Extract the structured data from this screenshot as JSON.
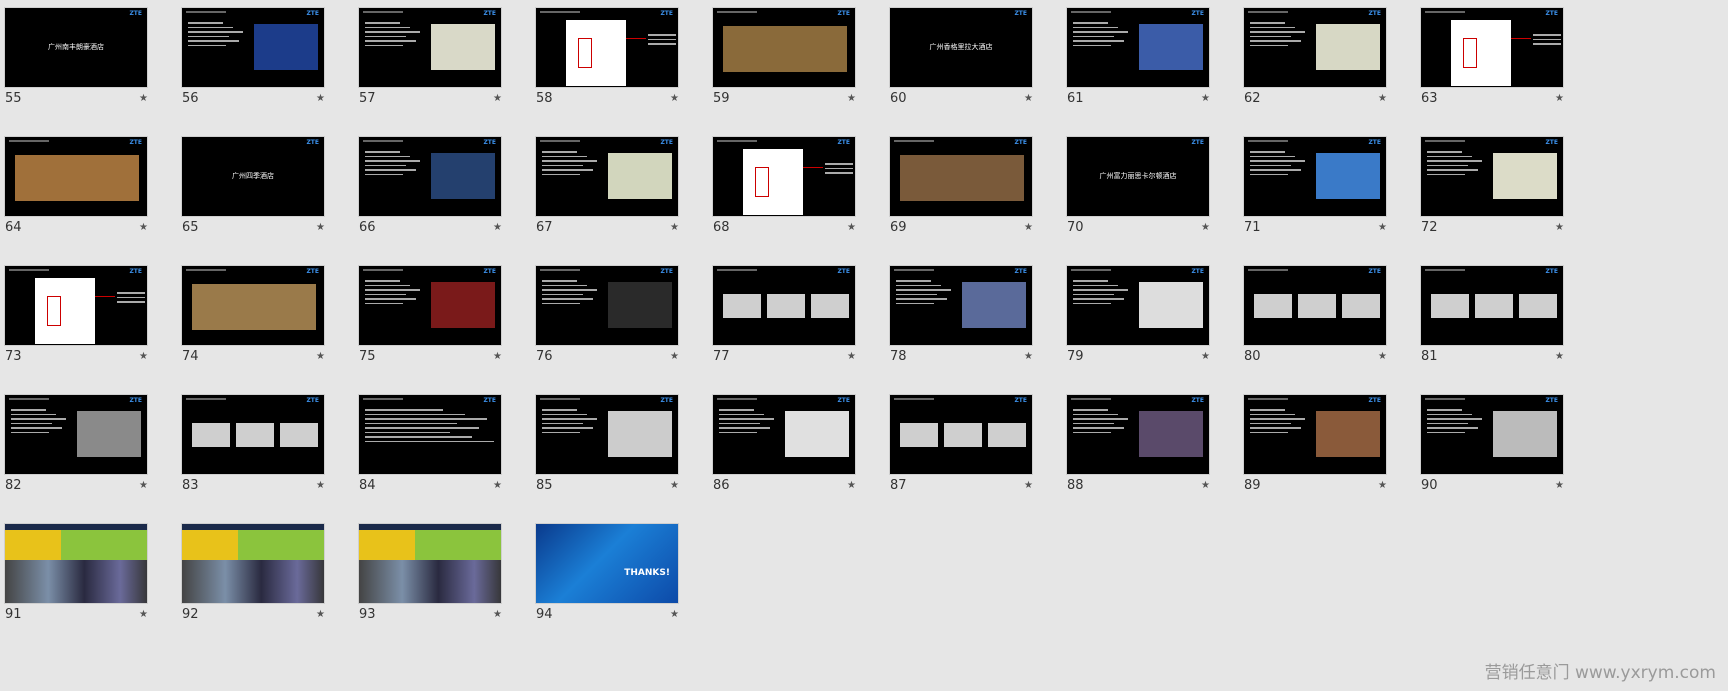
{
  "header": "ZTE",
  "star_glyph": "★",
  "watermark": "营销任意门 www.yxrym.com",
  "slides": [
    {
      "n": "55",
      "style": "title",
      "title": "广州南丰朗豪酒店"
    },
    {
      "n": "56",
      "style": "text-pic",
      "pic": "#1c3c8a"
    },
    {
      "n": "57",
      "style": "text-pic",
      "pic": "#d9d9c8"
    },
    {
      "n": "58",
      "style": "plan"
    },
    {
      "n": "59",
      "style": "pic",
      "pic": "#8a6a3a"
    },
    {
      "n": "60",
      "style": "title",
      "title": "广州香格里拉大酒店"
    },
    {
      "n": "61",
      "style": "text-pic",
      "pic": "#3b5ca8"
    },
    {
      "n": "62",
      "style": "text-pic",
      "pic": "#d7d8c5"
    },
    {
      "n": "63",
      "style": "plan"
    },
    {
      "n": "64",
      "style": "pic",
      "pic": "#a0703a"
    },
    {
      "n": "65",
      "style": "title",
      "title": "广州四季酒店"
    },
    {
      "n": "66",
      "style": "text-pic",
      "pic": "#24406e"
    },
    {
      "n": "67",
      "style": "text-pic",
      "pic": "#d2d6bd"
    },
    {
      "n": "68",
      "style": "plan"
    },
    {
      "n": "69",
      "style": "pic",
      "pic": "#7a5a3a"
    },
    {
      "n": "70",
      "style": "title",
      "title": "广州富力丽思卡尔顿酒店"
    },
    {
      "n": "71",
      "style": "text-pic",
      "pic": "#3a7ac8"
    },
    {
      "n": "72",
      "style": "text-pic",
      "pic": "#dcdcc8"
    },
    {
      "n": "73",
      "style": "plan"
    },
    {
      "n": "74",
      "style": "pic",
      "pic": "#9a7a4a"
    },
    {
      "n": "75",
      "style": "text-pic",
      "pic": "#7a1a1a"
    },
    {
      "n": "76",
      "style": "text-pic",
      "pic": "#2a2a2a"
    },
    {
      "n": "77",
      "style": "boxes"
    },
    {
      "n": "78",
      "style": "text-pic",
      "pic": "#5a6a9a"
    },
    {
      "n": "79",
      "style": "text-pic",
      "pic": "#dddddd"
    },
    {
      "n": "80",
      "style": "boxes"
    },
    {
      "n": "81",
      "style": "boxes"
    },
    {
      "n": "82",
      "style": "text-pic",
      "pic": "#8a8a8a"
    },
    {
      "n": "83",
      "style": "boxes"
    },
    {
      "n": "84",
      "style": "text"
    },
    {
      "n": "85",
      "style": "text-pic",
      "pic": "#cccccc"
    },
    {
      "n": "86",
      "style": "text-pic",
      "pic": "#e0e0e0"
    },
    {
      "n": "87",
      "style": "boxes"
    },
    {
      "n": "88",
      "style": "text-pic",
      "pic": "#5a4a6a"
    },
    {
      "n": "89",
      "style": "text-pic",
      "pic": "#8a5a3a"
    },
    {
      "n": "90",
      "style": "text-pic",
      "pic": "#bbbbbb"
    },
    {
      "n": "91",
      "style": "colorful"
    },
    {
      "n": "92",
      "style": "colorful"
    },
    {
      "n": "93",
      "style": "colorful"
    },
    {
      "n": "94",
      "style": "thanks",
      "title": "THANKS!"
    }
  ]
}
